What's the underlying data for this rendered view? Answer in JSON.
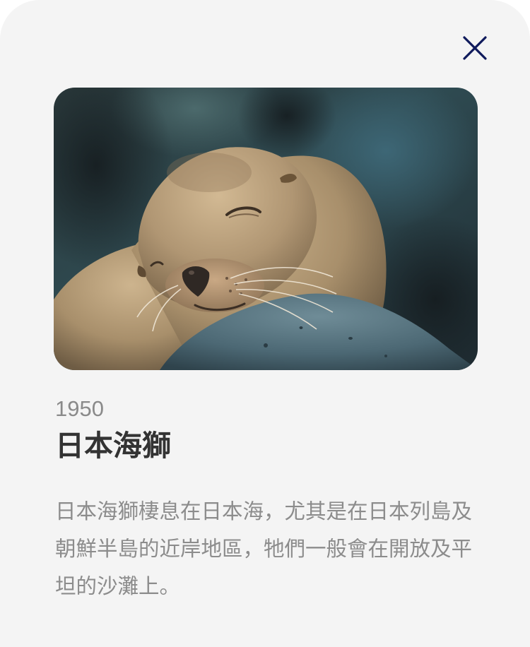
{
  "card": {
    "year": "1950",
    "title": "日本海獅",
    "description": "日本海獅棲息在日本海，尤其是在日本列島及朝鮮半島的近岸地區，牠們一般會在開放及平坦的沙灘上。",
    "photo_subject": "sea-lion-sleeping-on-rock"
  },
  "controls": {
    "close_icon": "close-icon"
  },
  "colors": {
    "sheet_background": "#f4f4f4",
    "close_icon": "#0f1a5c",
    "title": "#333333",
    "year": "#8a8a8a",
    "description": "#8c8c8c"
  }
}
